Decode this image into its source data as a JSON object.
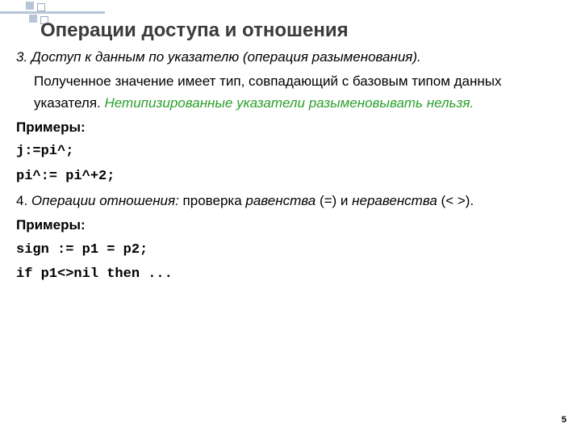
{
  "slide": {
    "title": "Операции доступа и отношения",
    "section3": {
      "lead": "3. Доступ к данным  по указателю (операция разыменования).",
      "text": "Полученное  значение имеет тип, совпадающий с базовым типом данных указателя. ",
      "note": "Нетипизированные указатели разыменовывать нельзя.",
      "examples_label": "Примеры:",
      "code1": "j:=pi^;",
      "code2": "pi^:= pi^+2;"
    },
    "section4": {
      "lead_prefix": "4. ",
      "lead_italic": "Операции отношения:",
      "lead_rest": " проверка ",
      "eq_word": "равенства",
      "eq_sym": " (=) и ",
      "neq_word": "неравенства",
      "neq_sym": " (< >).",
      "examples_label": "Примеры:",
      "code1": "sign := p1 = p2;",
      "code2": "if p1<>nil then ..."
    },
    "page_number": "5"
  }
}
